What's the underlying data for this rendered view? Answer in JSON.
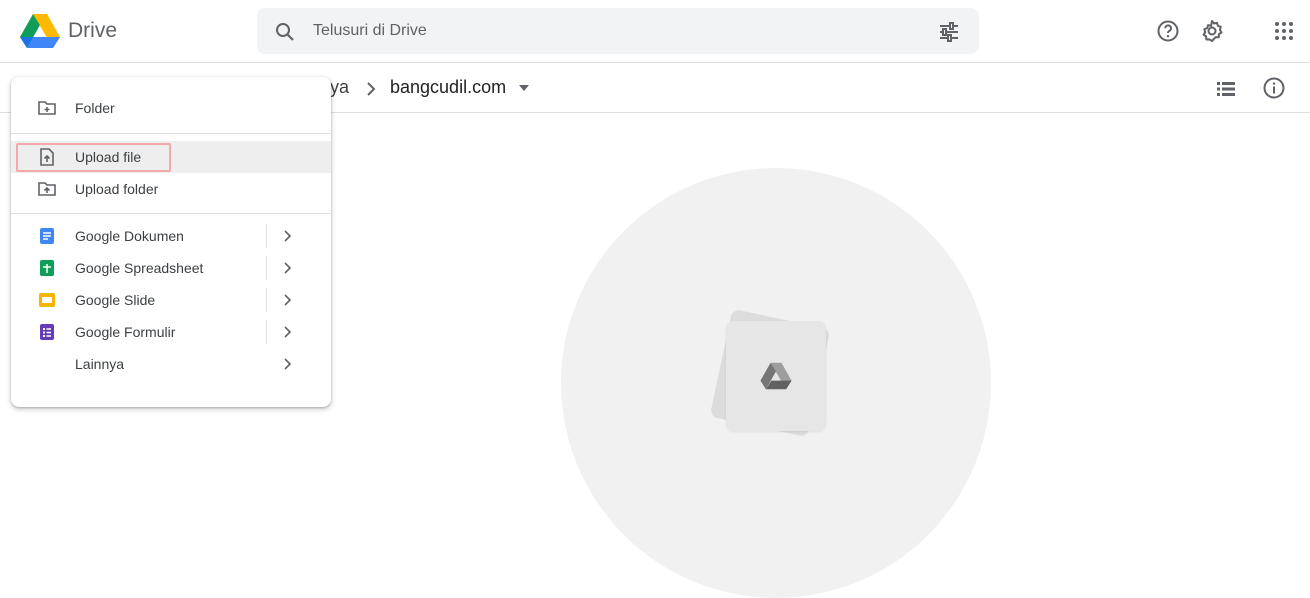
{
  "header": {
    "app_name": "Drive",
    "search_placeholder": "Telusuri di Drive"
  },
  "breadcrumb": {
    "previous_partial": "ya",
    "current": "bangcudil.com"
  },
  "menu": {
    "folder": "Folder",
    "upload_file": "Upload file",
    "upload_folder": "Upload folder",
    "docs": "Google Dokumen",
    "sheets": "Google Spreadsheet",
    "slides": "Google Slide",
    "forms": "Google Formulir",
    "more": "Lainnya"
  },
  "colors": {
    "docs_blue": "#4285f4",
    "sheets_green": "#0f9d58",
    "slides_yellow": "#f4b400",
    "forms_purple": "#673ab7",
    "highlight_border": "#f1a9ac"
  },
  "icons": [
    "drive-logo-icon",
    "search-icon",
    "tune-icon",
    "help-icon",
    "gear-icon",
    "apps-grid-icon",
    "chevron-right-icon",
    "caret-down-icon",
    "list-view-icon",
    "info-icon",
    "new-folder-icon",
    "upload-file-icon",
    "upload-folder-icon",
    "docs-icon",
    "sheets-icon",
    "slides-icon",
    "forms-icon"
  ]
}
